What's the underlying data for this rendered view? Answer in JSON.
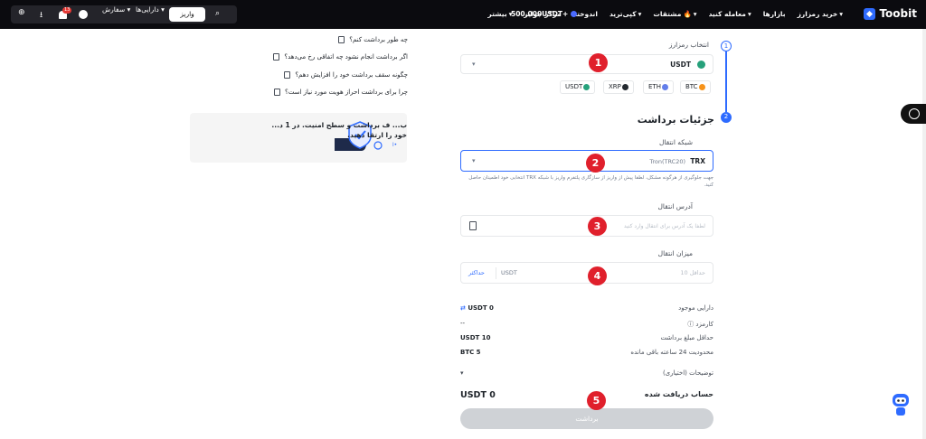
{
  "nav": {
    "brand": "Toobit",
    "links": [
      "خرید رمزارز",
      "بازارها",
      "معامله کنید",
      "مشتقات",
      "کپی‌ترید",
      "اندوخته",
      "مرکز جوایز",
      "بیشتر"
    ],
    "balance": "500,000USDT+",
    "order": "سفارش",
    "assets": "دارایی‌ها",
    "deposit": "واریز",
    "notifications": "13",
    "icons": [
      "search-icon",
      "user-icon",
      "bell-icon",
      "download-icon",
      "globe-icon"
    ]
  },
  "form": {
    "choose_coin_label": "انتخاب رمزارز",
    "selected_coin": "USDT",
    "quick_coins": [
      "BTC",
      "ETH",
      "XRP",
      "USDT"
    ],
    "details_title": "جزئیات برداشت",
    "network_label": "شبکه انتقال",
    "network_value": "TRX",
    "network_sub": "Tron(TRC20)",
    "network_note": "جهت جلوگیری از هرگونه مشکل، لطفا پیش از واریز از سازگاری پلتفرم واریز با شبکه TRX انتخابی خود اطمینان حاصل کنید.",
    "address_label": "آدرس انتقال",
    "address_placeholder": "لطفا یک آدرس برای انتقال وارد کنید",
    "amount_label": "میزان انتقال",
    "amount_placeholder": "حداقل 10",
    "amount_unit": "USDT",
    "max_label": "حداکثر",
    "available_label": "دارایی موجود",
    "available_value": "USDT 0",
    "fee_label": "کارمزد",
    "fee_value": "--",
    "min_label": "حداقل مبلغ برداشت",
    "min_value": "USDT 10",
    "limit_label": "محدودیت 24 ساعته باقی مانده",
    "limit_value": "BTC 5",
    "remark_label": "توضیحات (اختیاری)",
    "receive_label": "حساب دریافت شده",
    "receive_value": "USDT 0",
    "submit": "برداشت"
  },
  "markers": [
    "1",
    "2",
    "3",
    "4",
    "5"
  ],
  "steps": [
    "1",
    "2"
  ],
  "faq": [
    "چه طور برداشت کنم؟",
    "اگر برداشت انجام نشود چه اتفاقی رخ می‌دهد؟",
    "چگونه سقف برداشت خود را افزایش دهم؟",
    "چرا برای برداشت احراز هویت مورد نیاز است؟"
  ],
  "promo": {
    "text": "ب... ف برداشت و سطح امنیت. در 1 د... خود را ارتقا دهید.",
    "link": "ا•"
  },
  "colors": {
    "accent": "#2e6bff",
    "marker": "#e0202c",
    "nav_bg": "#0b0b0f"
  }
}
